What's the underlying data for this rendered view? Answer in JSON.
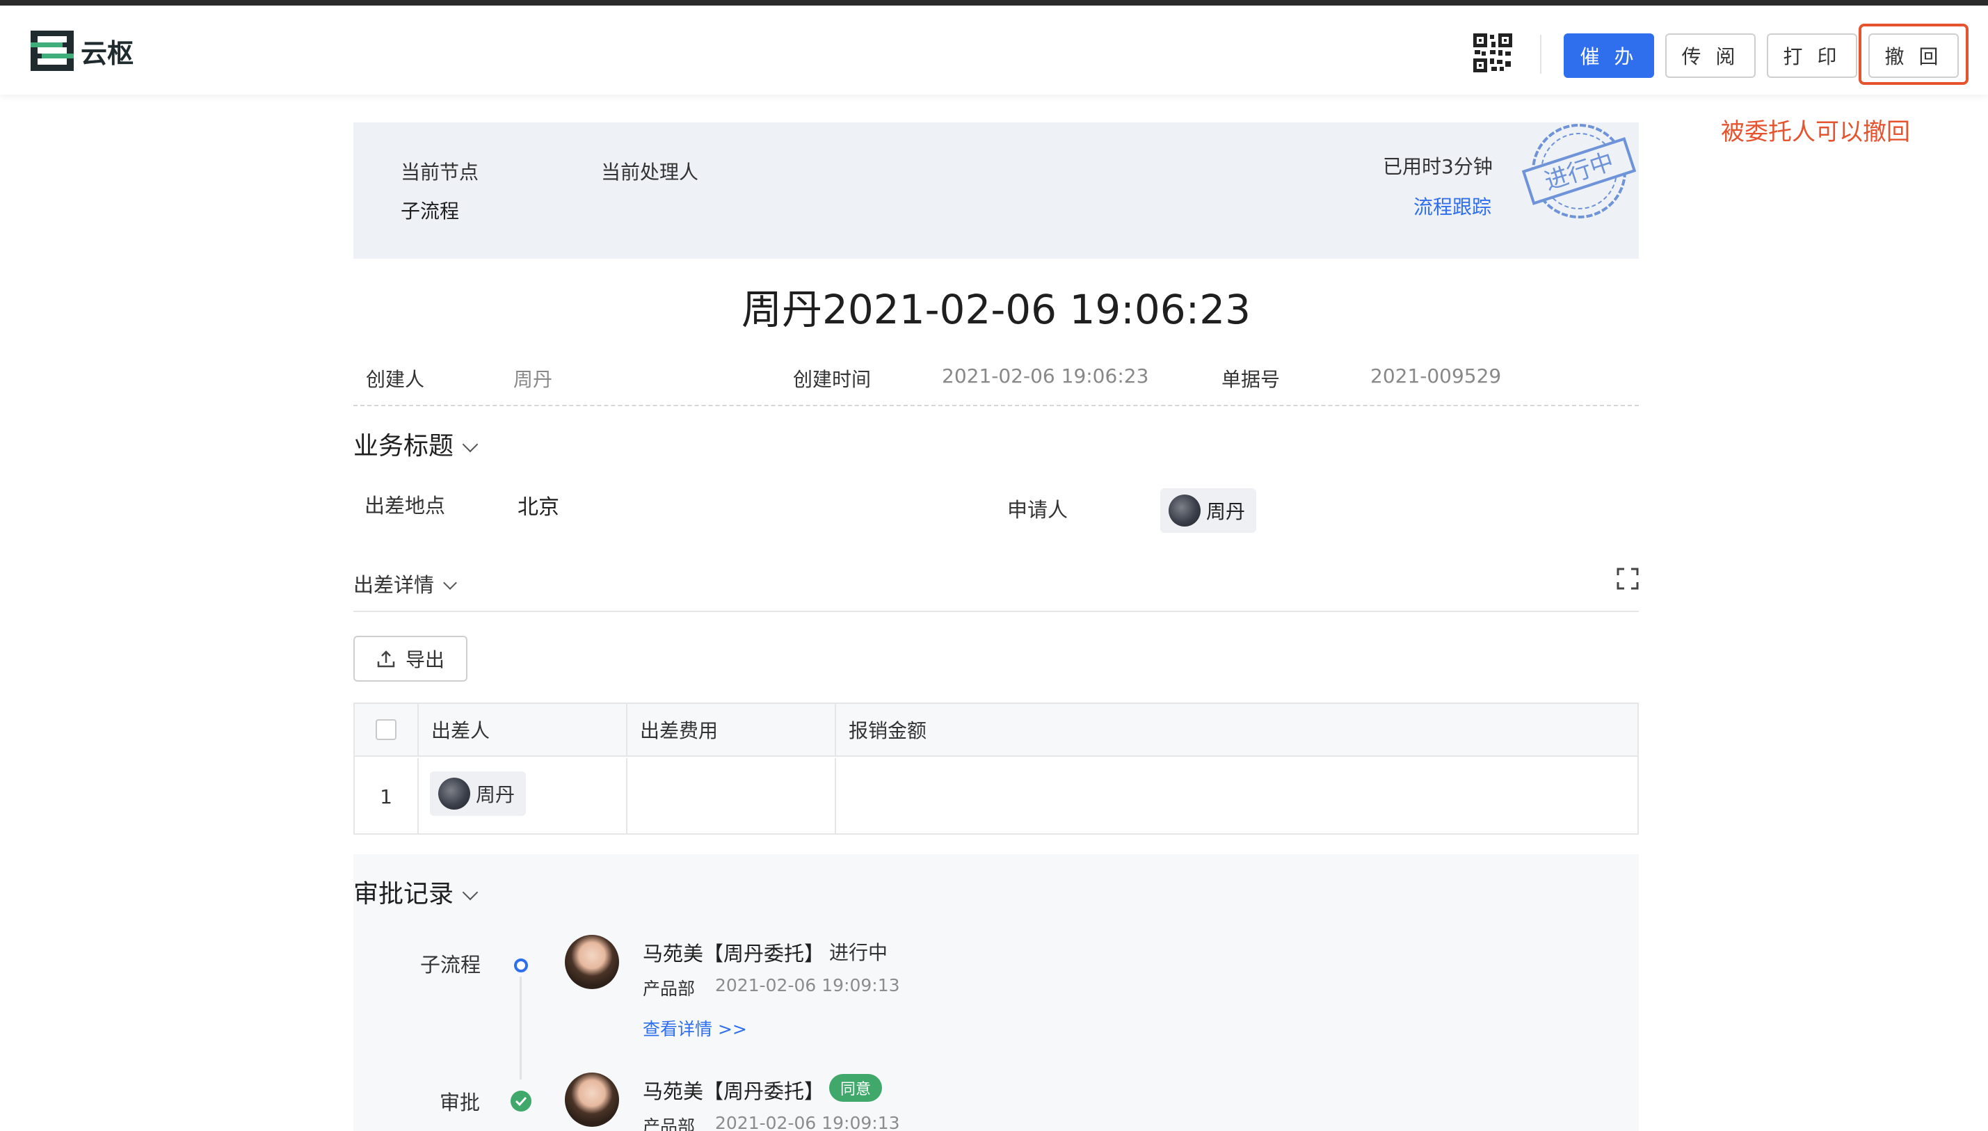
{
  "brand": {
    "name": "云枢"
  },
  "header": {
    "actions": {
      "urge": "催 办",
      "circulate": "传 阅",
      "print": "打 印",
      "withdraw": "撤 回"
    },
    "annotation": "被委托人可以撤回",
    "highlight_color": "#e5532f",
    "primary_color": "#2f6fed"
  },
  "status": {
    "node_label": "当前节点",
    "node_value": "子流程",
    "handler_label": "当前处理人",
    "elapsed": "已用时3分钟",
    "track_link": "流程跟踪",
    "stamp_text": "进行中"
  },
  "form": {
    "title": "周丹2021-02-06 19:06:23",
    "meta": {
      "creator_label": "创建人",
      "creator": "周丹",
      "created_label": "创建时间",
      "created": "2021-02-06 19:06:23",
      "number_label": "单据号",
      "number": "2021-009529"
    },
    "section_title": "业务标题",
    "location_label": "出差地点",
    "location": "北京",
    "applicant_label": "申请人",
    "applicant": "周丹",
    "detail_title": "出差详情",
    "export_label": "导出",
    "table": {
      "columns": [
        "出差人",
        "出差费用",
        "报销金额"
      ],
      "rows": [
        {
          "index": "1",
          "traveler": "周丹",
          "cost": "",
          "reimburse": ""
        }
      ]
    }
  },
  "approval": {
    "title": "审批记录",
    "records": [
      {
        "node": "子流程",
        "name": "马苑美【周丹委托】",
        "status": "进行中",
        "dept": "产品部",
        "time": "2021-02-06 19:09:13",
        "link": "查看详情 >>"
      },
      {
        "node": "审批",
        "name": "马苑美【周丹委托】",
        "badge": "同意",
        "dept": "产品部",
        "time": "2021-02-06 19:09:13"
      }
    ]
  }
}
